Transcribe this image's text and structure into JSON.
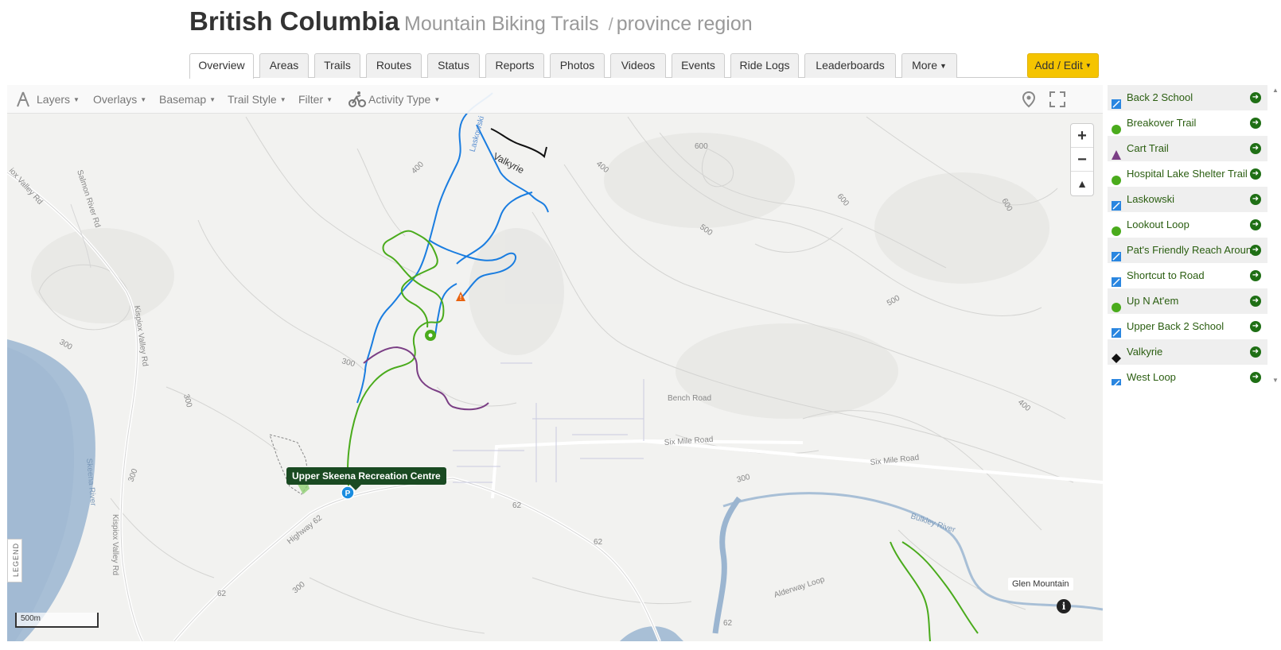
{
  "header": {
    "region": "British Columbia",
    "subtitle": "Mountain Biking Trails",
    "separator": "/",
    "kind": "province region"
  },
  "tabs": [
    {
      "label": "Overview",
      "active": true
    },
    {
      "label": "Areas"
    },
    {
      "label": "Trails"
    },
    {
      "label": "Routes"
    },
    {
      "label": "Status"
    },
    {
      "label": "Reports"
    },
    {
      "label": "Photos"
    },
    {
      "label": "Videos"
    },
    {
      "label": "Events"
    },
    {
      "label": "Ride Logs"
    },
    {
      "label": "Leaderboards"
    },
    {
      "label": "More"
    }
  ],
  "add_edit_label": "Add / Edit",
  "toolbar": {
    "layers": "Layers",
    "overlays": "Overlays",
    "basemap": "Basemap",
    "trail_style": "Trail Style",
    "filter": "Filter",
    "activity_type": "Activity Type"
  },
  "map": {
    "legend_label": "LEGEND",
    "scale_label": "500m",
    "poi_tooltip": "Upper Skeena Recreation Centre",
    "place_label": "Glen Mountain",
    "labels": {
      "laskowski": "Laskowski",
      "valkyrie": "Valkyrie",
      "bench_road": "Bench Road",
      "six_mile_1": "Six Mile Road",
      "six_mile_2": "Six Mile Road",
      "highway": "Highway 62",
      "kispiox_1": "Kispiox Valley Rd",
      "kispiox_2": "Kispiox Valley Rd",
      "salmon": "Salmon River Rd",
      "kispiox_top": "iox Valley Rd",
      "bulkley": "Bulkley River",
      "alderway": "Alderway Loop",
      "r62a": "62",
      "r62b": "62",
      "r62c": "62",
      "r62d": "62",
      "c600a": "600",
      "c600b": "600",
      "c600c": "600",
      "c400a": "400",
      "c400b": "400",
      "c500a": "500",
      "c500b": "500",
      "c400c": "400",
      "c300a": "300",
      "c300b": "300",
      "c300c": "300",
      "c300d": "300",
      "c300e": "300",
      "c300f": "300",
      "skeena": "Skeena River"
    }
  },
  "colors": {
    "blue_trail": "#1a7de0",
    "green_trail": "#4aab1c",
    "purple_trail": "#7b3f85",
    "black_trail": "#111111",
    "accent": "#f5c400",
    "list_text": "#2a5d10"
  },
  "trails": [
    {
      "name": "Back 2 School",
      "icon": "blue-square-icon"
    },
    {
      "name": "Breakover Trail",
      "icon": "green-circle-icon"
    },
    {
      "name": "Cart Trail",
      "icon": "purple-triangle-icon"
    },
    {
      "name": "Hospital Lake Shelter Trail",
      "icon": "green-circle-icon"
    },
    {
      "name": "Laskowski",
      "icon": "blue-square-icon"
    },
    {
      "name": "Lookout Loop",
      "icon": "green-circle-icon"
    },
    {
      "name": "Pat's Friendly Reach Around",
      "icon": "blue-square-icon"
    },
    {
      "name": "Shortcut to Road",
      "icon": "blue-square-icon"
    },
    {
      "name": "Up N At'em",
      "icon": "green-circle-icon"
    },
    {
      "name": "Upper Back 2 School",
      "icon": "blue-square-icon"
    },
    {
      "name": "Valkyrie",
      "icon": "black-diamond-icon"
    },
    {
      "name": "West Loop",
      "icon": "blue-square-icon"
    }
  ]
}
